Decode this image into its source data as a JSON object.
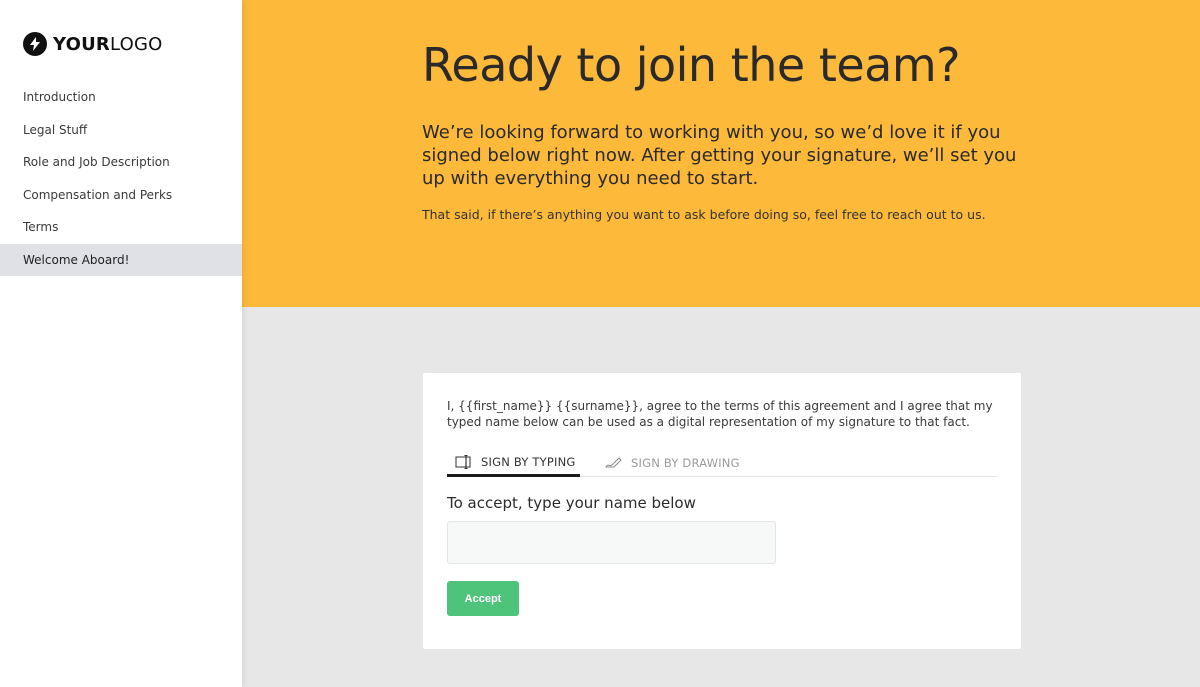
{
  "sidebar": {
    "logo": {
      "bold": "YOUR",
      "light": "LOGO",
      "icon": "lightning-bolt-icon"
    },
    "items": [
      {
        "label": "Introduction"
      },
      {
        "label": "Legal Stuff"
      },
      {
        "label": "Role and Job Description"
      },
      {
        "label": "Compensation and Perks"
      },
      {
        "label": "Terms"
      },
      {
        "label": "Welcome Aboard!",
        "active": true
      }
    ]
  },
  "hero": {
    "title": "Ready to join the team?",
    "lead": "We’re looking forward to working with you, so we’d love it if you signed below right now. After getting your signature, we’ll set you up with everything you need to start.",
    "sub": "That said, if there’s anything you want to ask before doing so, feel free to reach out to us.",
    "background": "#fdb93a"
  },
  "signature": {
    "agreement": "I, {{first_name}} {{surname}}, agree to the terms of this agreement and I agree that my typed name below can be used as a digital representation of my signature to that fact.",
    "tabs": [
      {
        "label": "SIGN BY TYPING",
        "icon": "text-cursor-icon",
        "active": true
      },
      {
        "label": "SIGN BY DRAWING",
        "icon": "pen-icon",
        "active": false
      }
    ],
    "input_label": "To accept, type your name below",
    "input_value": "",
    "input_placeholder": "",
    "accept_label": "Accept",
    "accept_color": "#4dc47a"
  }
}
